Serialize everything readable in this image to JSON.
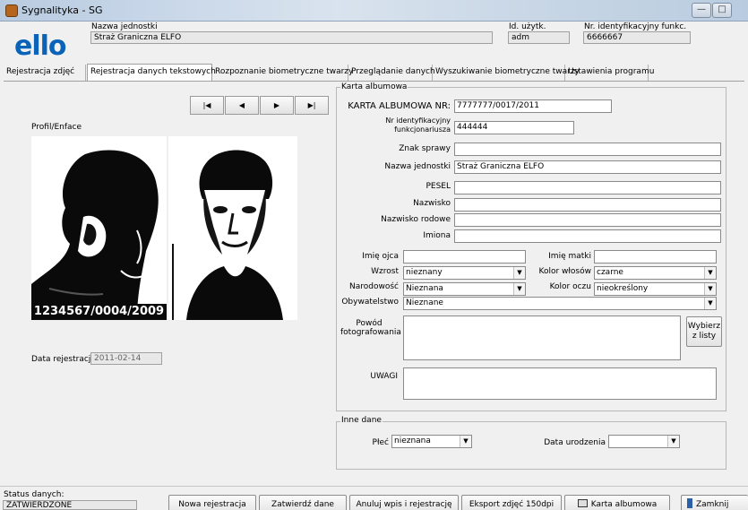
{
  "window": {
    "title": "Sygnalityka - SG",
    "minimize": "—",
    "maximize": "□"
  },
  "header": {
    "logo": "ello",
    "unit_label": "Nazwa jednostki",
    "unit_value": "Straż Graniczna ELFO",
    "user_id_label": "Id. użytk.",
    "user_id_value": "adm",
    "officer_id_label": "Nr. identyfikacyjny funkc.",
    "officer_id_value": "6666667"
  },
  "tabs": [
    {
      "label": "Rejestracja zdjęć"
    },
    {
      "label": "Rejestracja danych tekstowych"
    },
    {
      "label": "Rozpoznanie biometryczne twarzy"
    },
    {
      "label": "Przeglądanie danych"
    },
    {
      "label": "Wyszukiwanie biometryczne twarzy"
    },
    {
      "label": "Ustawienia programu"
    }
  ],
  "nav": {
    "first": "|◀",
    "prev": "◀",
    "next": "▶",
    "last": "▶|"
  },
  "photo": {
    "label": "Profil/Enface",
    "caption": "1234567/0004/2009"
  },
  "registration": {
    "label": "Data rejestracji",
    "value": "2011-02-14"
  },
  "card": {
    "group_title": "Karta albumowa",
    "album_no_label": "KARTA ALBUMOWA NR:",
    "album_no_value": "7777777/0017/2011",
    "officer_label_1": "Nr identyfikacyjny",
    "officer_label_2": "funkcjonariusza",
    "officer_value": "444444",
    "case_label": "Znak sprawy",
    "case_value": "",
    "unit_label": "Nazwa jednostki",
    "unit_value": "Straż Graniczna ELFO",
    "pesel_label": "PESEL",
    "pesel_value": "",
    "surname_label": "Nazwisko",
    "surname_value": "",
    "family_name_label": "Nazwisko rodowe",
    "family_name_value": "",
    "names_label": "Imiona",
    "names_value": "",
    "father_label": "Imię ojca",
    "father_value": "",
    "mother_label": "Imię matki",
    "mother_value": "",
    "height_label": "Wzrost",
    "height_value": "nieznany",
    "hair_label": "Kolor włosów",
    "hair_value": "czarne",
    "nationality_label": "Narodowość",
    "nationality_value": "Nieznana",
    "eyes_label": "Kolor oczu",
    "eyes_value": "nieokreślony",
    "citizenship_label": "Obywatelstwo",
    "citizenship_value": "Nieznane",
    "reason_label_1": "Powód",
    "reason_label_2": "fotografowania",
    "reason_value": "",
    "choose_btn_1": "Wybierz",
    "choose_btn_2": "z listy",
    "notes_label": "UWAGI",
    "notes_value": ""
  },
  "other": {
    "group_title": "Inne dane",
    "sex_label": "Płeć",
    "sex_value": "nieznana",
    "birth_label": "Data urodzenia",
    "birth_value": ""
  },
  "status": {
    "label": "Status danych:",
    "value": "ZATWIERDZONE",
    "buttons": {
      "new": "Nowa rejestracja",
      "confirm": "Zatwierdź dane",
      "cancel": "Anuluj wpis i rejestrację",
      "export": "Eksport zdjęć 150dpi",
      "album": "Karta albumowa",
      "close": "Zamknij"
    }
  },
  "colors": {
    "logo": "#0a63b8",
    "titlebar": "#c7d6e8"
  }
}
